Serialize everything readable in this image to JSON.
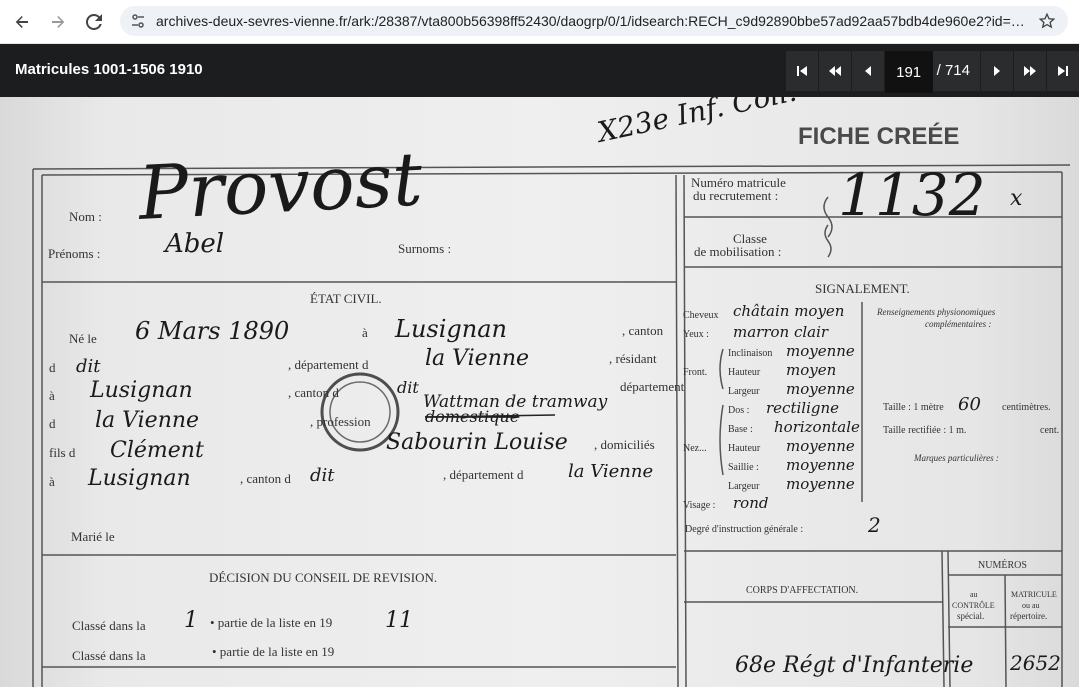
{
  "browser": {
    "url": "archives-deux-sevres-vienne.fr/ark:/28387/vta800b56398ff52430/daogrp/0/1/idsearch:RECH_c9d92890bbe57ad92aa57bdb4de960e2?id=htt..."
  },
  "viewer": {
    "title": "Matricules 1001-1506 1910",
    "page_current": "191",
    "page_total": "/ 714"
  },
  "document": {
    "stamp_fiche": "FICHE CREÉE",
    "pencil_note": "X23e Inf. Coll.",
    "labels": {
      "nom": "Nom :",
      "prenoms": "Prénoms :",
      "surnoms": "Surnoms :",
      "numero_matricule_1": "Numéro matricule",
      "numero_matricule_2": "du recrutement :",
      "classe_1": "Classe",
      "classe_2": "de mobilisation :",
      "etat_civil": "ÉTAT CIVIL.",
      "signalement": "SIGNALEMENT.",
      "ne_le": "Né le",
      "a": "à",
      "canton": ", canton",
      "d": "d",
      "departement_d": ", département d",
      "residant": ", résidant",
      "canton_d": ", canton d",
      "departement": "département",
      "profession": ", profession",
      "fils_d": "fils d",
      "domicilies": ", domiciliés",
      "canton_d2": ", canton d",
      "departement_d2": ", département d",
      "marie_le": "Marié le",
      "cheveux": "Cheveux",
      "yeux": "Yeux :",
      "front": "Front.",
      "inclinaison": "Inclinaison",
      "hauteur": "Hauteur",
      "largeur": "Largeur",
      "dos": "Dos :",
      "base": "Base :",
      "nez": "Nez...",
      "hauteur2": "Hauteur",
      "saillie": "Saillie :",
      "largeur2": "Largeur",
      "visage": "Visage :",
      "degre": "Degré d'instruction générale :",
      "renseignements_1": "Renseignements physionomiques",
      "renseignements_2": "complémentaires :",
      "taille": "Taille : 1 mètre",
      "centimetres": "centimètres.",
      "taille_rectifiee": "Taille rectifiée : 1 m.",
      "cent": "cent.",
      "marques": "Marques particulières :",
      "decision": "DÉCISION DU CONSEIL DE REVISION.",
      "classe_dans_1": "Classé dans la",
      "partie_1": "• partie de la liste en 19",
      "classe_dans_2": "Classé dans la",
      "partie_2": "• partie de la liste en 19",
      "corps": "CORPS D'AFFECTATION.",
      "numeros": "NUMÉROS",
      "au_controle_1": "au",
      "au_controle_2": "CONTRÔLE",
      "au_controle_3": "spécial.",
      "matricule_1": "MATRICULE",
      "matricule_2": "ou au",
      "matricule_3": "répertoire."
    },
    "handwritten": {
      "nom": "Provost",
      "prenom": "Abel",
      "matricule": "1132",
      "matricule_mark": "x",
      "date_naissance": "6 Mars 1890",
      "lieu_naissance": "Lusignan",
      "d_dit": "dit",
      "departement": "la Vienne",
      "residant": "Lusignan",
      "canton_dit": "dit",
      "profession": "Wattman de tramway",
      "profession_struck": "domestique",
      "departement2": "la Vienne",
      "pere": "Clément",
      "mere": "Sabourin Louise",
      "domicile": "Lusignan",
      "domicile_canton": "dit",
      "domicile_dept": "la Vienne",
      "cheveux": "châtain moyen",
      "yeux": "marron clair",
      "inclinaison": "moyenne",
      "hauteur": "moyen",
      "largeur": "moyenne",
      "dos": "rectiligne",
      "base": "horizontale",
      "nez_hauteur": "moyenne",
      "saillie": "moyenne",
      "nez_largeur": "moyenne",
      "visage": "rond",
      "taille_cm": "60",
      "instruction": "2",
      "partie_1": "1",
      "annee_1": "11",
      "corps": "68e Régt d'Infanterie",
      "matricule_corps": "2652"
    }
  }
}
